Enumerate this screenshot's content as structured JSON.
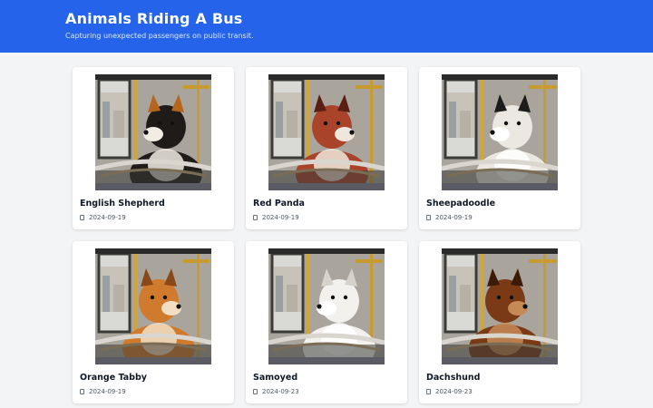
{
  "header": {
    "title": "Animals Riding A Bus",
    "subtitle": "Capturing unexpected passengers on public transit.",
    "bg_color": "#2563eb"
  },
  "cards": [
    {
      "title": "English Shepherd",
      "date": "2024-09-19",
      "icon": "calendar-icon",
      "colors": {
        "body": "#1f1b19",
        "accent": "#b5651d",
        "white": "#f1ece4"
      }
    },
    {
      "title": "Red Panda",
      "date": "2024-09-19",
      "icon": "calendar-icon",
      "colors": {
        "body": "#a9432a",
        "accent": "#5a1e12",
        "white": "#efe7dc"
      }
    },
    {
      "title": "Sheepadoodle",
      "date": "2024-09-19",
      "icon": "calendar-icon",
      "colors": {
        "body": "#ebe7e1",
        "accent": "#1c1c1c",
        "white": "#ffffff"
      }
    },
    {
      "title": "Orange Tabby",
      "date": "2024-09-19",
      "icon": "calendar-icon",
      "colors": {
        "body": "#d07a2e",
        "accent": "#8a4718",
        "white": "#f2dfc3"
      }
    },
    {
      "title": "Samoyed",
      "date": "2024-09-23",
      "icon": "calendar-icon",
      "colors": {
        "body": "#f2f1ee",
        "accent": "#d6d3cc",
        "white": "#ffffff"
      }
    },
    {
      "title": "Dachshund",
      "date": "2024-09-23",
      "icon": "calendar-icon",
      "colors": {
        "body": "#7a3a16",
        "accent": "#3b1a08",
        "white": "#c58a55"
      }
    }
  ]
}
